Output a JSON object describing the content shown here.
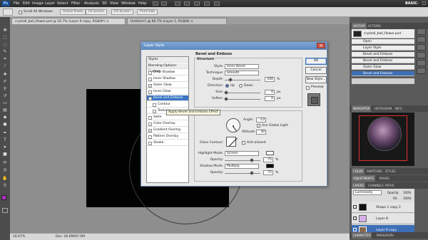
{
  "menubar": {
    "app_logo": "Ps",
    "items": [
      "File",
      "Edit",
      "Image",
      "Layer",
      "Select",
      "Filter",
      "Analysis",
      "3D",
      "View",
      "Window",
      "Help"
    ],
    "workspace": "BASIC",
    "window_controls": [
      "–",
      "□",
      "×"
    ]
  },
  "options_bar": {
    "scroll_all_label": "Scroll All Windows",
    "buttons": [
      "Actual Pixels",
      "Fit Screen",
      "Fill Screen",
      "Print Size"
    ]
  },
  "tabs": [
    {
      "label": "crystall_ball_flower.psd @ 16.7% (Layer 6 copy, RGB/8*) ×",
      "active": true
    },
    {
      "label": "Untitled-1 @ 66.7% (Layer 1, RGB/8) ×",
      "active": false
    }
  ],
  "status_bar": {
    "zoom": "16.67%",
    "doc": "Doc: 26.6M/87.0M"
  },
  "history_panel": {
    "tabs": [
      "HISTORY",
      "ACTIONS"
    ],
    "snapshot": "crystall_ball_flower.psd",
    "items": [
      "Open",
      "Layer Style",
      "Bevel and Emboss",
      "Bevel and Emboss",
      "Outer Glow",
      "Bevel and Emboss"
    ],
    "selected_index": 5
  },
  "navigator_panel": {
    "tabs": [
      "NAVIGATOR",
      "HISTOGRAM",
      "INFO"
    ]
  },
  "color_panel": {
    "tabs": [
      "COLOR",
      "SWATCHES",
      "STYLES"
    ]
  },
  "adjustments_panel": {
    "tabs": [
      "ADJUSTMENTS",
      "MASKS"
    ]
  },
  "layers_panel": {
    "tabs": [
      "LAYERS",
      "CHANNELS",
      "PATHS"
    ],
    "blend_mode": "Luminosity",
    "opacity_label": "Opacity:",
    "opacity_value": "100%",
    "fill_label": "Fill:",
    "fill_value": "100%",
    "layers": [
      {
        "name": "Shape 1 copy 2",
        "selected": false
      },
      {
        "name": "Layer 8",
        "selected": false
      },
      {
        "name": "Layer 9 copy",
        "selected": true
      }
    ]
  },
  "bottom_tabs": [
    "CHARACTER",
    "PARAGRAPH"
  ],
  "dialog": {
    "title": "Layer Style",
    "close": "×",
    "style_items": [
      {
        "label": "Styles",
        "checked": null,
        "kind": "head"
      },
      {
        "label": "Blending Options: Custom",
        "checked": null,
        "kind": "head"
      },
      {
        "label": "Drop Shadow",
        "checked": false
      },
      {
        "label": "Inner Shadow",
        "checked": false
      },
      {
        "label": "Outer Glow",
        "checked": true
      },
      {
        "label": "Inner Glow",
        "checked": false
      },
      {
        "label": "Bevel and Emboss",
        "checked": true,
        "selected": true
      },
      {
        "label": "Contour",
        "checked": false,
        "indent": true
      },
      {
        "label": "Texture",
        "checked": false,
        "indent": true
      },
      {
        "label": "Satin",
        "checked": false
      },
      {
        "label": "Color Overlay",
        "checked": false
      },
      {
        "label": "Gradient Overlay",
        "checked": true
      },
      {
        "label": "Pattern Overlay",
        "checked": false
      },
      {
        "label": "Stroke",
        "checked": false
      }
    ],
    "buttons": {
      "ok": "OK",
      "cancel": "Cancel",
      "new_style": "New Style...",
      "preview": "Preview"
    },
    "structure": {
      "group_title": "Bevel and Emboss",
      "section_title": "Structure",
      "style_label": "Style:",
      "style_value": "Inner Bevel",
      "technique_label": "Technique:",
      "technique_value": "Smooth",
      "depth_label": "Depth:",
      "depth_value": "100",
      "depth_unit": "%",
      "direction_label": "Direction:",
      "direction_up": "Up",
      "direction_down": "Down",
      "size_label": "Size:",
      "size_value": "0",
      "size_unit": "px",
      "soften_label": "Soften:",
      "soften_value": "0",
      "soften_unit": "px"
    },
    "shading": {
      "angle_label": "Angle:",
      "angle_value": "-53",
      "global_light_label": "Use Global Light",
      "altitude_label": "Altitude:",
      "altitude_value": "30",
      "gloss_label": "Gloss Contour:",
      "anti_aliased_label": "Anti-aliased",
      "highlight_label": "Highlight Mode:",
      "highlight_mode": "Screen",
      "highlight_color": "#ffffff",
      "opacity_label": "Opacity:",
      "highlight_opacity": "75",
      "shadow_label": "Shadow Mode:",
      "shadow_mode": "Multiply",
      "shadow_color": "#000000",
      "shadow_opacity": "75",
      "pct": "%"
    },
    "tooltip": "Apply Bevel and Emboss Effect"
  }
}
